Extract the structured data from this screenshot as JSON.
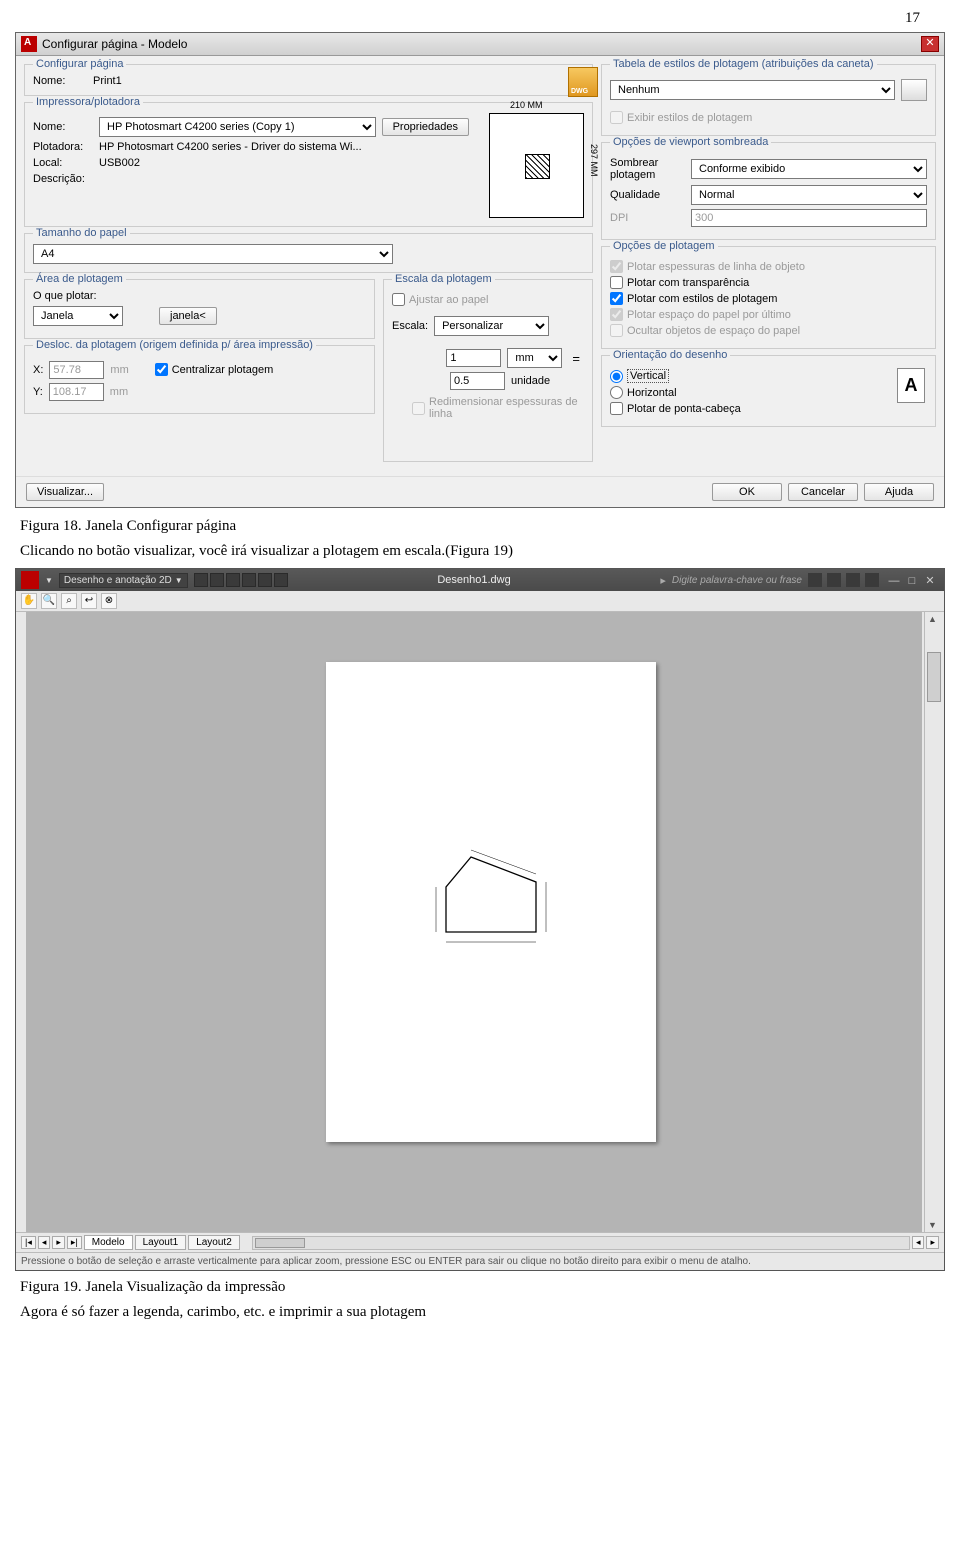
{
  "page_number": "17",
  "dialog": {
    "title": "Configurar página - Modelo",
    "groups": {
      "config_pagina": "Configurar página",
      "impressora": "Impressora/plotadora",
      "tamanho": "Tamanho do papel",
      "area": "Área de plotagem",
      "desloc": "Desloc. da plotagem (origem definida p/ área impressão)",
      "escala": "Escala da plotagem",
      "tabela_estilos": "Tabela de estilos de plotagem (atribuições da caneta)",
      "viewport": "Opções de viewport sombreada",
      "opcoes_plot": "Opções de plotagem",
      "orientacao": "Orientação do desenho"
    },
    "labels": {
      "nome": "Nome:",
      "plotadora": "Plotadora:",
      "local": "Local:",
      "descricao": "Descrição:",
      "propriedades": "Propriedades",
      "o_que_plotar": "O que plotar:",
      "janela_btn": "janela<",
      "x": "X:",
      "y": "Y:",
      "mm_unit": "mm",
      "centralizar": "Centralizar plotagem",
      "ajustar": "Ajustar ao papel",
      "escala_lbl": "Escala:",
      "unidade": "unidade",
      "redimensionar": "Redimensionar espessuras de linha",
      "exibir_estilos": "Exibir estilos de plotagem",
      "sombrear": "Sombrear plotagem",
      "qualidade": "Qualidade",
      "dpi": "DPI",
      "plot_espessuras": "Plotar espessuras de linha de objeto",
      "plot_transp": "Plotar com transparência",
      "plot_estilos": "Plotar com estilos de plotagem",
      "plot_espaco": "Plotar espaço do papel por último",
      "ocultar": "Ocultar objetos de espaço do papel",
      "vertical": "Vertical",
      "horizontal": "Horizontal",
      "ponta_cabeca": "Plotar de ponta-cabeça"
    },
    "values": {
      "nome_val": "Print1",
      "impressora_sel": "HP Photosmart C4200 series (Copy 1)",
      "plotadora_val": "HP Photosmart C4200 series - Driver do sistema Wi...",
      "local_val": "USB002",
      "paper_w": "210 MM",
      "paper_h": "297 MM",
      "papel_sel": "A4",
      "area_sel": "Janela",
      "x_val": "57.78",
      "y_val": "108.17",
      "escala_sel": "Personalizar",
      "escala_num": "1",
      "escala_unit": "mm",
      "escala_den": "0.5",
      "estilo_sel": "Nenhum",
      "sombrear_sel": "Conforme exibido",
      "qualidade_sel": "Normal",
      "dpi_val": "300",
      "orient_letter": "A"
    },
    "footer": {
      "visualizar": "Visualizar...",
      "ok": "OK",
      "cancelar": "Cancelar",
      "ajuda": "Ajuda"
    }
  },
  "captions": {
    "fig18": "Figura 18. Janela Configurar página",
    "midtext": "Clicando no botão visualizar, você irá visualizar a plotagem em escala.(Figura 19)",
    "fig19": "Figura 19. Janela Visualização da impressão",
    "bottom": "Agora é só fazer a legenda, carimbo, etc. e imprimir a sua plotagem"
  },
  "acad": {
    "workspace": "Desenho e anotação 2D",
    "docname": "Desenho1.dwg",
    "search_hint": "Digite palavra-chave ou frase",
    "tabs": {
      "modelo": "Modelo",
      "l1": "Layout1",
      "l2": "Layout2"
    },
    "status": "Pressione o botão de seleção e arraste verticalmente para aplicar zoom, pressione ESC ou ENTER para sair ou clique no botão direito para exibir o menu de atalho."
  }
}
